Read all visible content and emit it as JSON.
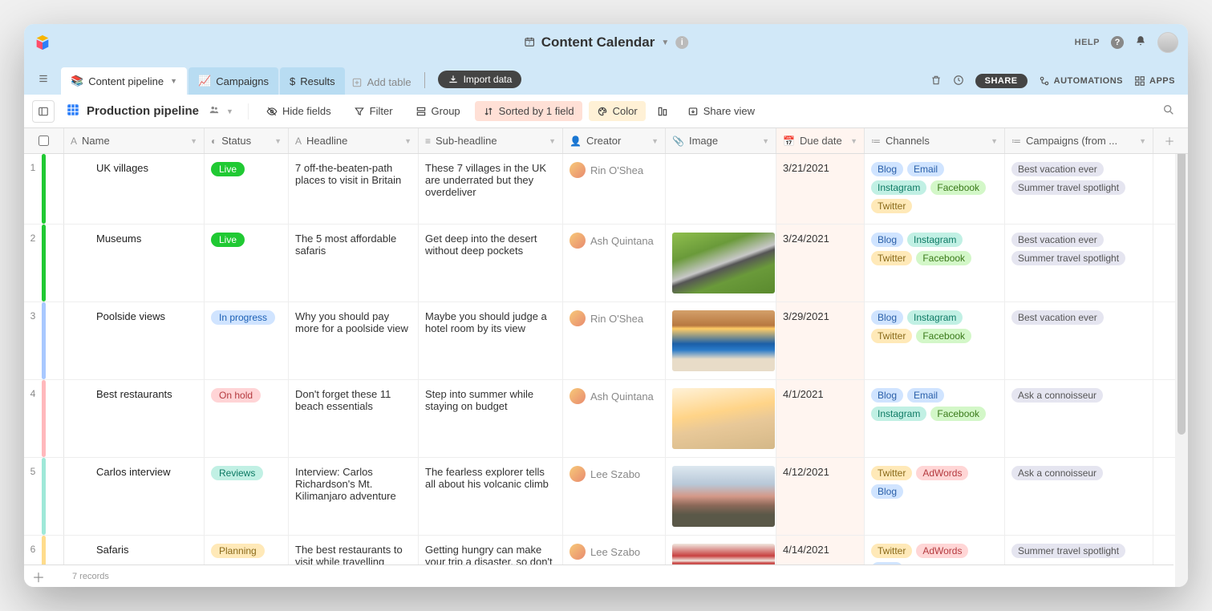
{
  "topbar": {
    "title": "Content Calendar",
    "help": "HELP"
  },
  "tabs": [
    {
      "label": "Content pipeline",
      "icon": "📚",
      "active": true
    },
    {
      "label": "Campaigns",
      "icon": "📈",
      "active": false
    },
    {
      "label": "Results",
      "icon": "$",
      "active": false
    }
  ],
  "add_table": "Add table",
  "import": "Import data",
  "share": "SHARE",
  "automations": "AUTOMATIONS",
  "apps": "APPS",
  "view": {
    "name": "Production pipeline",
    "hide_fields": "Hide fields",
    "filter": "Filter",
    "group": "Group",
    "sorted": "Sorted by 1 field",
    "color": "Color",
    "share_view": "Share view"
  },
  "columns": {
    "name": "Name",
    "status": "Status",
    "headline": "Headline",
    "sub": "Sub-headline",
    "creator": "Creator",
    "image": "Image",
    "due": "Due date",
    "channels": "Channels",
    "campaigns": "Campaigns (from ..."
  },
  "status_colors": {
    "Live": "live",
    "In progress": "in-progress",
    "On hold": "on-hold",
    "Reviews": "reviews",
    "Planning": "planning"
  },
  "bar_colors": {
    "Live": "#20c933",
    "In progress": "#a8c8ff",
    "On hold": "#ffb8bc",
    "Reviews": "#9fe8d8",
    "Planning": "#ffdc8c"
  },
  "channel_class": {
    "Blog": "blog",
    "Email": "email",
    "Instagram": "instagram",
    "Facebook": "facebook",
    "Twitter": "twitter",
    "AdWords": "adwords"
  },
  "thumbs": {
    "zebra": "linear-gradient(160deg,#8fbf4d 0%,#6a9a3a 30%,#c8c8c8 50%,#555 55%,#6a9a3a 70%,#5a8a2e 100%)",
    "pool": "linear-gradient(180deg,#d4a06a 0%,#b87840 25%,#ffcc66 30%,#1a5fa8 55%,#2a7ac8 65%,#e8dcc8 80%)",
    "beach": "linear-gradient(170deg,#fff2d8 0%,#ffd488 40%,#e8c898 60%,#d4b888 100%)",
    "mountain": "linear-gradient(180deg,#dde8f0 0%,#b8c8d8 30%,#d49888 50%,#8a6858 65%,#5a5848 80%)",
    "cafe": "linear-gradient(180deg,#f0e8e0 0%,#c84040 20%,#f0e8e0 28%,#c84040 32%,#e8d8c8 40%,#8a6848 70%)"
  },
  "rows": [
    {
      "n": "1",
      "name": "UK villages",
      "status": "Live",
      "headline": "7 off-the-beaten-path places to visit in Britain",
      "sub": "These 7 villages in the UK are underrated but they overdeliver",
      "creator": "Rin O'Shea",
      "image": "",
      "due": "3/21/2021",
      "channels": [
        "Blog",
        "Email",
        "Instagram",
        "Facebook",
        "Twitter"
      ],
      "campaigns": [
        "Best vacation ever",
        "Summer travel spotlight"
      ]
    },
    {
      "n": "2",
      "name": "Museums",
      "status": "Live",
      "headline": "The 5 most affordable safaris",
      "sub": "Get deep into the desert without deep pockets",
      "creator": "Ash Quintana",
      "image": "zebra",
      "due": "3/24/2021",
      "channels": [
        "Blog",
        "Instagram",
        "Twitter",
        "Facebook"
      ],
      "campaigns": [
        "Best vacation ever",
        "Summer travel spotlight"
      ]
    },
    {
      "n": "3",
      "name": "Poolside views",
      "status": "In progress",
      "headline": "Why you should pay more for a poolside view",
      "sub": "Maybe you should judge a hotel room by its view",
      "creator": "Rin O'Shea",
      "image": "pool",
      "due": "3/29/2021",
      "channels": [
        "Blog",
        "Instagram",
        "Twitter",
        "Facebook"
      ],
      "campaigns": [
        "Best vacation ever"
      ]
    },
    {
      "n": "4",
      "name": "Best restaurants",
      "status": "On hold",
      "headline": "Don't forget these 11 beach essentials",
      "sub": "Step into summer while staying on budget",
      "creator": "Ash Quintana",
      "image": "beach",
      "due": "4/1/2021",
      "channels": [
        "Blog",
        "Email",
        "Instagram",
        "Facebook"
      ],
      "campaigns": [
        "Ask a connoisseur"
      ]
    },
    {
      "n": "5",
      "name": "Carlos interview",
      "status": "Reviews",
      "headline": "Interview: Carlos Richardson's Mt. Kilimanjaro adventure",
      "sub": "The fearless explorer tells all about his volcanic climb",
      "creator": "Lee Szabo",
      "image": "mountain",
      "due": "4/12/2021",
      "channels": [
        "Twitter",
        "AdWords",
        "Blog"
      ],
      "campaigns": [
        "Ask a connoisseur"
      ]
    },
    {
      "n": "6",
      "name": "Safaris",
      "status": "Planning",
      "headline": "The best restaurants to visit while travelling",
      "sub": "Getting hungry can make your trip a disaster, so don't skip a meal with our",
      "creator": "Lee Szabo",
      "image": "cafe",
      "due": "4/14/2021",
      "channels": [
        "Twitter",
        "AdWords",
        "Blog"
      ],
      "campaigns": [
        "Summer travel spotlight"
      ]
    }
  ],
  "footer": {
    "records": "7 records"
  }
}
